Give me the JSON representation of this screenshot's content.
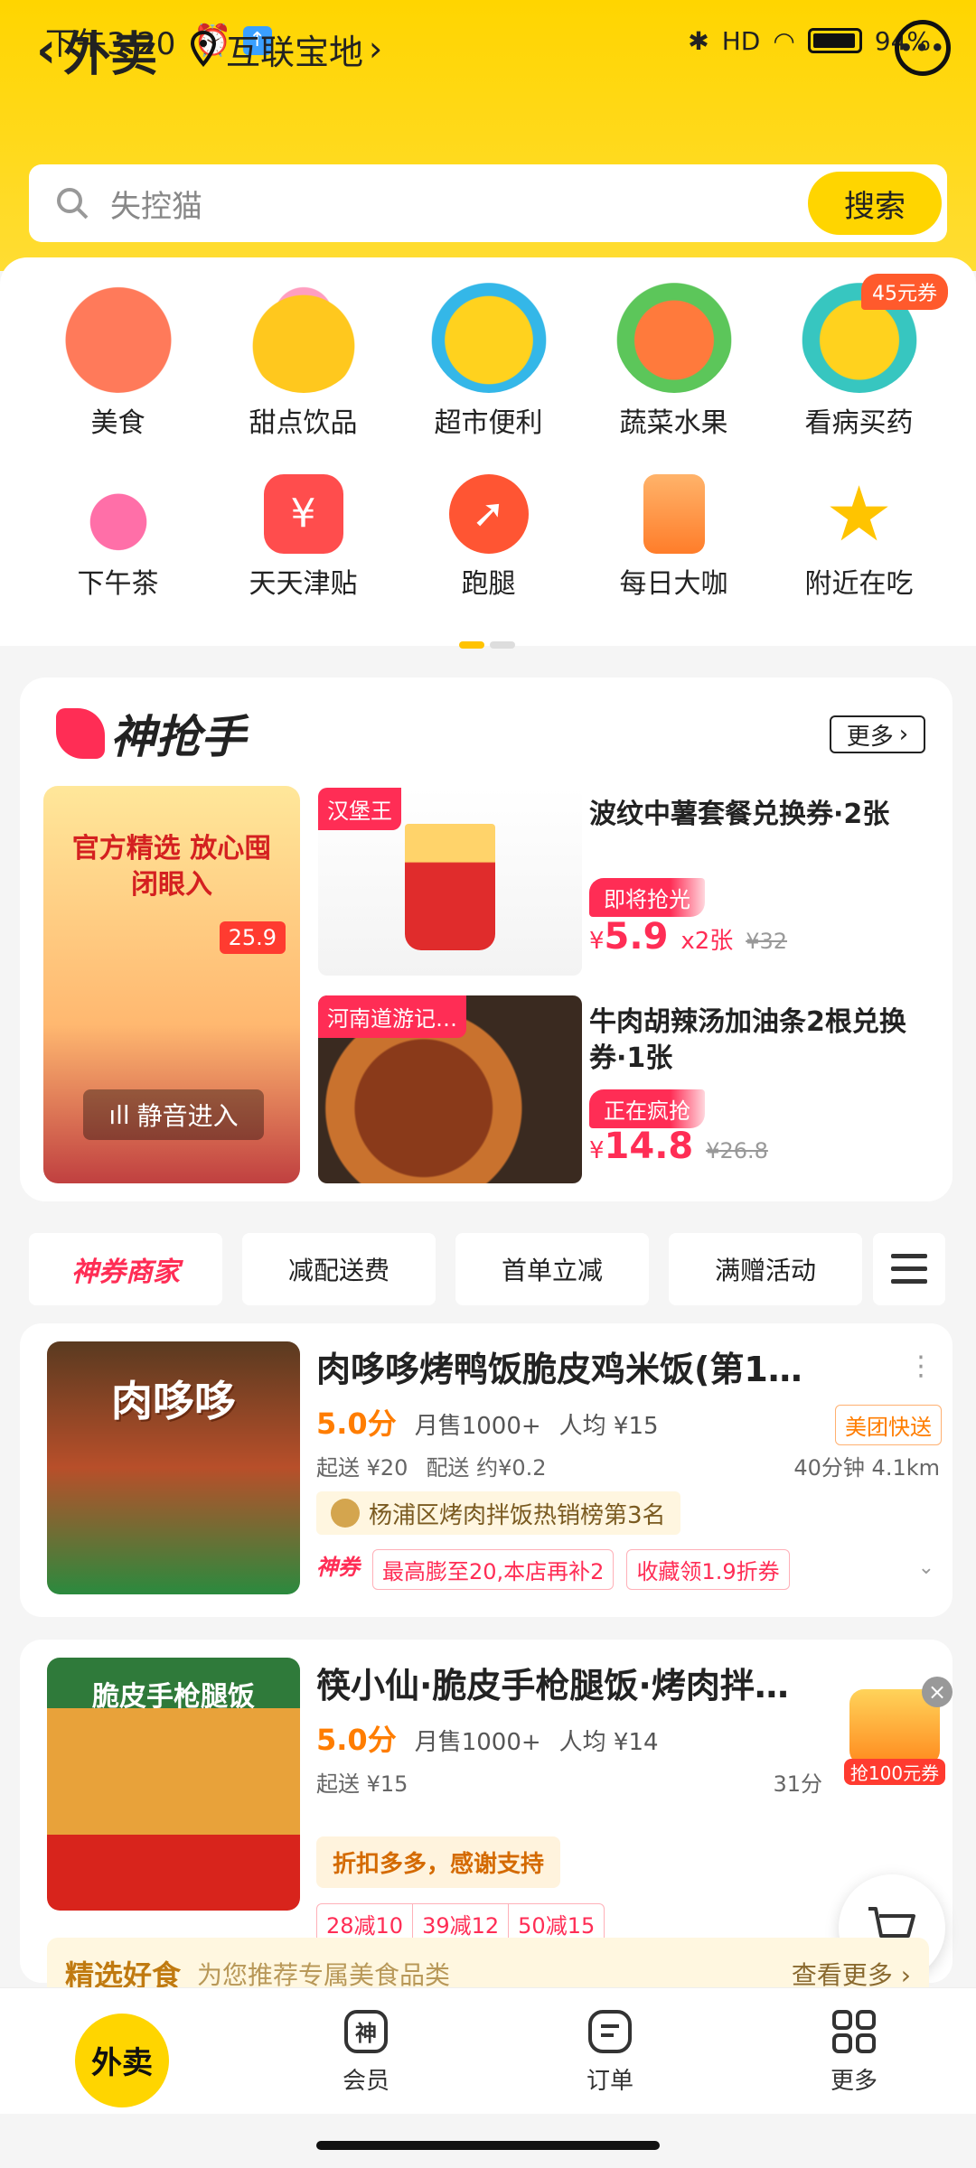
{
  "status_bar": {
    "time": "下午3:20",
    "battery": "94%",
    "network": "HD"
  },
  "header": {
    "back_label": "外卖",
    "location": "互联宝地",
    "message_icon": "chat-icon"
  },
  "search": {
    "placeholder": "失控猫",
    "button": "搜索"
  },
  "categories": [
    {
      "label": "美食",
      "icon": "noodles-icon"
    },
    {
      "label": "甜点饮品",
      "icon": "dessert-icon"
    },
    {
      "label": "超市便利",
      "icon": "basket-icon"
    },
    {
      "label": "蔬菜水果",
      "icon": "fruit-icon"
    },
    {
      "label": "看病买药",
      "icon": "medicine-icon",
      "badge": "45元券"
    },
    {
      "label": "下午茶",
      "icon": "coffee-cup-icon"
    },
    {
      "label": "天天津贴",
      "icon": "yen-icon"
    },
    {
      "label": "跑腿",
      "icon": "runner-icon"
    },
    {
      "label": "每日大咖",
      "icon": "coffee-icon"
    },
    {
      "label": "附近在吃",
      "icon": "star-icon"
    }
  ],
  "flash_sale": {
    "title": "神抢手",
    "more": "更多",
    "video": {
      "headline": "官方精选 放心囤 闭眼入",
      "price": "25.9",
      "mute_label": "静音进入"
    },
    "deals": [
      {
        "shop": "汉堡王",
        "title": "波纹中薯套餐兑换券·2张",
        "status": "即将抢光",
        "price_symbol": "¥",
        "price": "5.9",
        "qty": "x2张",
        "old_price": "¥32"
      },
      {
        "shop": "河南道游记…",
        "title": "牛肉胡辣汤加油条2根兑换券·1张",
        "status": "正在疯抢",
        "price_symbol": "¥",
        "price": "14.8",
        "qty": "",
        "old_price": "¥26.8"
      }
    ]
  },
  "filters": [
    "神券商家",
    "减配送费",
    "首单立减",
    "满赠活动"
  ],
  "stores": [
    {
      "name": "肉哆哆烤鸭饭脆皮鸡米饭(第1…",
      "score": "5.0分",
      "monthly": "月售1000+",
      "avg": "人均 ¥15",
      "min": "起送 ¥20",
      "delivery": "配送 约¥0.2",
      "eta": "40分钟",
      "distance": "4.1km",
      "fast": "美团快送",
      "rank": "杨浦区烤肉拌饭热销榜第3名",
      "promo_brand": "神券",
      "promo1": "最高膨至20,本店再补2",
      "promo2": "收藏领1.9折券",
      "cover_text": "肉哆哆"
    },
    {
      "name": "筷小仙·脆皮手枪腿饭·烤肉拌…",
      "score": "5.0分",
      "monthly": "月售1000+",
      "avg": "人均 ¥14",
      "min": "起送 ¥15",
      "eta": "31分",
      "support": "折扣多多，感谢支持",
      "reductions": [
        "28减10",
        "39减12",
        "50减15"
      ],
      "cover_text": "脆皮手枪腿饭"
    }
  ],
  "float_ad": {
    "label": "抢100元券"
  },
  "picks": {
    "title": "精选好食",
    "subtitle": "为您推荐专属美食品类",
    "more": "查看更多"
  },
  "tabbar": [
    {
      "label": "外卖"
    },
    {
      "label": "会员"
    },
    {
      "label": "订单"
    },
    {
      "label": "更多"
    }
  ],
  "colors": {
    "brand_yellow": "#ffd500",
    "accent_red": "#ff2d55",
    "orange": "#ff7d00"
  }
}
